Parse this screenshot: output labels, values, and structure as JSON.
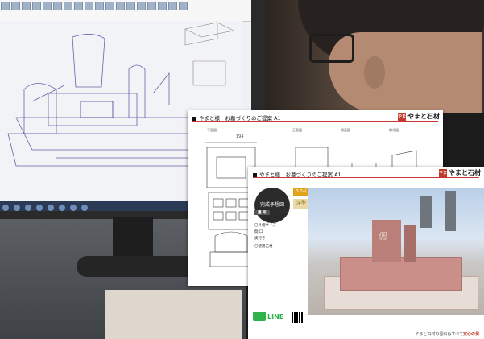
{
  "doc1": {
    "title": "やまと様　お墓づくりのご提案 A1",
    "logo_mark": "やまと",
    "logo_text": "やまと石材",
    "views": [
      "平面図",
      "正面図",
      "側面図",
      "斜視図"
    ],
    "dimension": "194"
  },
  "doc2": {
    "title": "やまと様　お墓づくりのご提案 A1",
    "logo_mark": "やまと",
    "logo_text": "やまと石材",
    "price_badge": "完成予想図",
    "size_badge": "3.7㎡",
    "type_badge": "洋型",
    "spec_label": "墓 所",
    "spec_value": "〇〇墓所",
    "spec_heading": "〇外柵サイズ",
    "spec_line1": "間 口",
    "spec_line2": "奥行き",
    "spec_heading2": "〇使用石材",
    "line_label": "LINE",
    "tomb_kanji": "偲",
    "footer_text": "やまと石材の墓石はすべて",
    "footer_em": "安心の保"
  }
}
